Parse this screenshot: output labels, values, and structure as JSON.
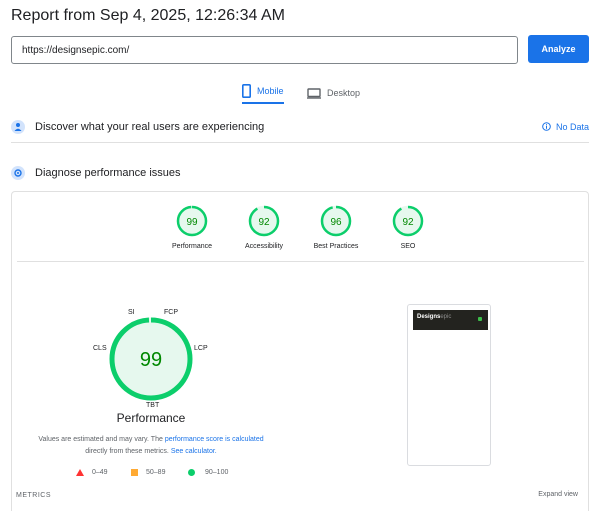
{
  "header": {
    "title": "Report from Sep 4, 2025, 12:26:34 AM"
  },
  "form": {
    "url_value": "https://designsepic.com/",
    "analyze_label": "Analyze"
  },
  "tabs": [
    {
      "label": "Mobile",
      "active": true
    },
    {
      "label": "Desktop",
      "active": false
    }
  ],
  "sections": {
    "real_users": {
      "title": "Discover what your real users are experiencing",
      "no_data_label": "No Data"
    },
    "diagnose": {
      "title": "Diagnose performance issues"
    }
  },
  "scores": [
    {
      "label": "Performance",
      "value": 99
    },
    {
      "label": "Accessibility",
      "value": 92
    },
    {
      "label": "Best Practices",
      "value": 96
    },
    {
      "label": "SEO",
      "value": 92
    }
  ],
  "performance": {
    "score": 99,
    "title": "Performance",
    "metric_labels": {
      "si": "SI",
      "fcp": "FCP",
      "lcp": "LCP",
      "tbt": "TBT",
      "cls": "CLS"
    },
    "note_prefix": "Values are estimated and may vary. The",
    "note_link1": "performance score is calculated",
    "note_middle": "directly from these metrics.",
    "note_link2": "See calculator."
  },
  "legend": [
    {
      "range": "0–49",
      "color": "#ff3333"
    },
    {
      "range": "50–89",
      "color": "#ffaa33"
    },
    {
      "range": "90–100",
      "color": "#0cce6b"
    }
  ],
  "screenshot": {
    "logo_main": "Designs",
    "logo_accent": "epic"
  },
  "metrics": {
    "heading": "METRICS",
    "expand_label": "Expand view"
  },
  "colors": {
    "accent": "#1a73e8",
    "pass": "#0cce6b",
    "pass_text": "#008800",
    "pass_fill": "#e6f8ee"
  }
}
